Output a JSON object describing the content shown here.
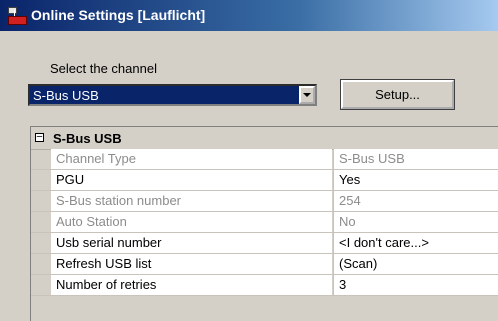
{
  "window": {
    "title": "Online Settings [Lauflicht]"
  },
  "channel": {
    "label": "Select the channel",
    "selected": "S-Bus USB",
    "setup_label": "Setup..."
  },
  "grid": {
    "group_title": "S-Bus USB",
    "group_toggle": "−",
    "rows": [
      {
        "name": "Channel Type",
        "value": "S-Bus USB",
        "disabled": true
      },
      {
        "name": "PGU",
        "value": "Yes",
        "disabled": false
      },
      {
        "name": "S-Bus station number",
        "value": "254",
        "disabled": true
      },
      {
        "name": "Auto Station",
        "value": "No",
        "disabled": true
      },
      {
        "name": "Usb serial number",
        "value": "<I don't care...>",
        "disabled": false
      },
      {
        "name": "Refresh USB list",
        "value": "(Scan)",
        "disabled": false
      },
      {
        "name": "Number of retries",
        "value": "3",
        "disabled": false
      }
    ]
  },
  "colors": {
    "titlebar": "#0a246a",
    "disabled_text": "#8c8c8c",
    "selection": "#0a246a"
  }
}
